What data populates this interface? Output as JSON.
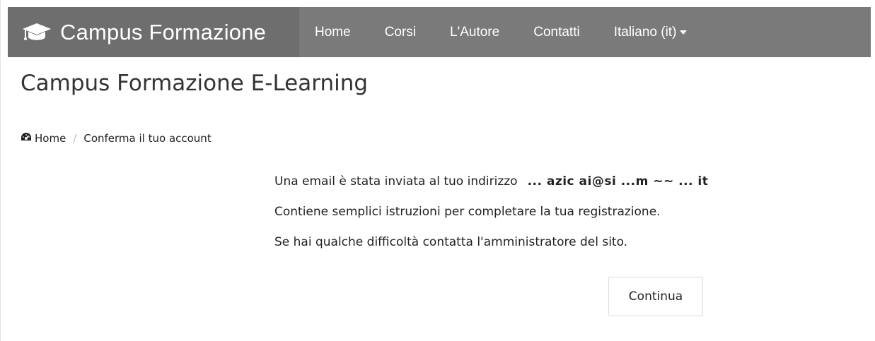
{
  "navbar": {
    "brand": {
      "icon": "graduation-cap-icon",
      "title": "Campus Formazione"
    },
    "items": [
      {
        "label": "Home"
      },
      {
        "label": "Corsi"
      },
      {
        "label": "L'Autore"
      },
      {
        "label": "Contatti"
      },
      {
        "label": "Italiano (it)",
        "icon": "caret-down-icon"
      }
    ]
  },
  "page": {
    "title": "Campus Formazione E-Learning"
  },
  "breadcrumb": {
    "home_icon": "dashboard-icon",
    "home_label": "Home",
    "current": "Conferma il tuo account"
  },
  "content": {
    "line1": "Una email è stata inviata al tuo indirizzo",
    "email": "... azic ai@si ...m ~~ ... it",
    "line2": "Contiene semplici istruzioni per completare la tua registrazione.",
    "line3": "Se hai qualche difficoltà contatta l'amministratore del sito."
  },
  "actions": {
    "continue_label": "Continua"
  },
  "colors": {
    "navbar_bg": "#7a7a7a",
    "brand_bg": "#6e6e6e",
    "nav_text": "#ffffff"
  }
}
